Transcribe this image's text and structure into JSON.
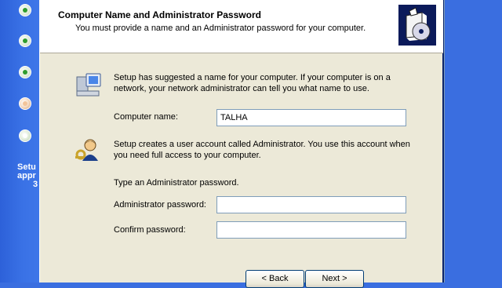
{
  "sidebar": {
    "steps": [
      {
        "state": "done"
      },
      {
        "state": "done"
      },
      {
        "state": "done"
      },
      {
        "state": "active"
      },
      {
        "state": "pending"
      }
    ],
    "lines": [
      "Setu",
      "appr",
      "3"
    ]
  },
  "header": {
    "title": "Computer Name and Administrator Password",
    "subtitle": "You must provide a name and an Administrator password for your computer."
  },
  "computer_section": {
    "icon": "computer-icon",
    "text_line1": "Setup has suggested a name for your computer.  If your computer is on a",
    "text_line2": "network, your network administrator can tell you what name to use.",
    "name_label": "Computer name:",
    "name_value": "TALHA"
  },
  "admin_section": {
    "icon": "users-key-icon",
    "text_line1": "Setup creates a user account called Administrator.  You use this account when",
    "text_line2": "you need full access to your computer.",
    "prompt": "Type an Administrator password.",
    "password_label": "Administrator password:",
    "password_value": "",
    "confirm_label": "Confirm password:",
    "confirm_value": ""
  },
  "buttons": {
    "back": "< Back",
    "next": "Next >"
  },
  "colors": {
    "desktop_blue": "#3a6ee0",
    "dialog_bg": "#ece9d8",
    "textbox_border": "#7f9db9"
  }
}
